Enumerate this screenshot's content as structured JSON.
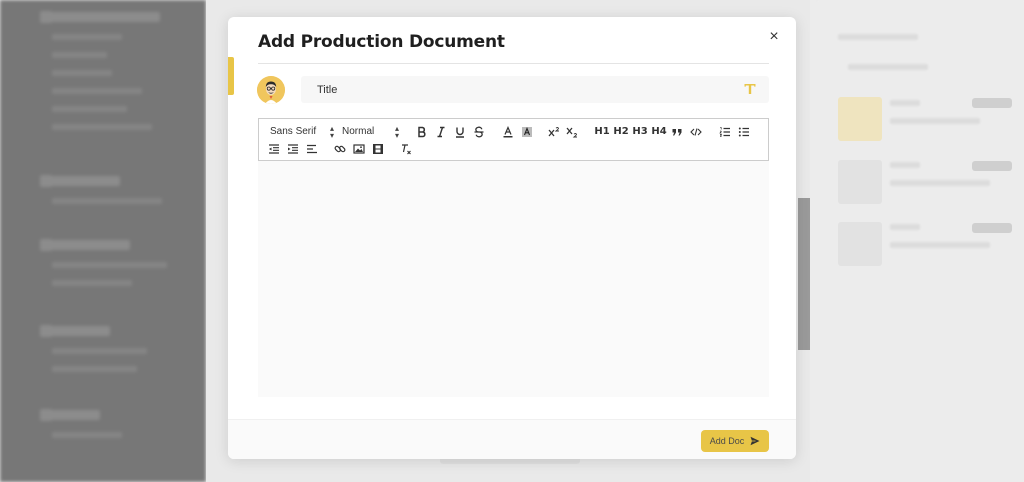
{
  "modal": {
    "title": "Add Production Document",
    "close_symbol": "×",
    "title_field": {
      "placeholder": "Title",
      "value": ""
    },
    "title_icon": "text-t-icon",
    "avatar": "avatar-illustration-glasses",
    "editor_content": ""
  },
  "toolbar": {
    "font_select": "Sans Serif",
    "size_select": "Normal",
    "buttons": [
      "bold-icon",
      "italic-icon",
      "underline-icon",
      "strikethrough-icon",
      "font-color-icon",
      "background-color-icon",
      "superscript-icon",
      "subscript-icon",
      "heading-1",
      "heading-2",
      "heading-3",
      "heading-4",
      "blockquote-icon",
      "code-block-icon",
      "ordered-list-icon",
      "bullet-list-icon",
      "outdent-icon",
      "indent-icon",
      "align-icon",
      "link-icon",
      "image-icon",
      "video-icon",
      "clear-format-icon"
    ],
    "h1": "H1",
    "h2": "H2",
    "h3": "H3",
    "h4": "H4"
  },
  "footer": {
    "add_button": "Add Doc",
    "add_icon": "send-icon"
  },
  "colors": {
    "accent": "#e8c547",
    "overlay_sidebar": "#777777",
    "editor_bg": "#fafafa"
  }
}
